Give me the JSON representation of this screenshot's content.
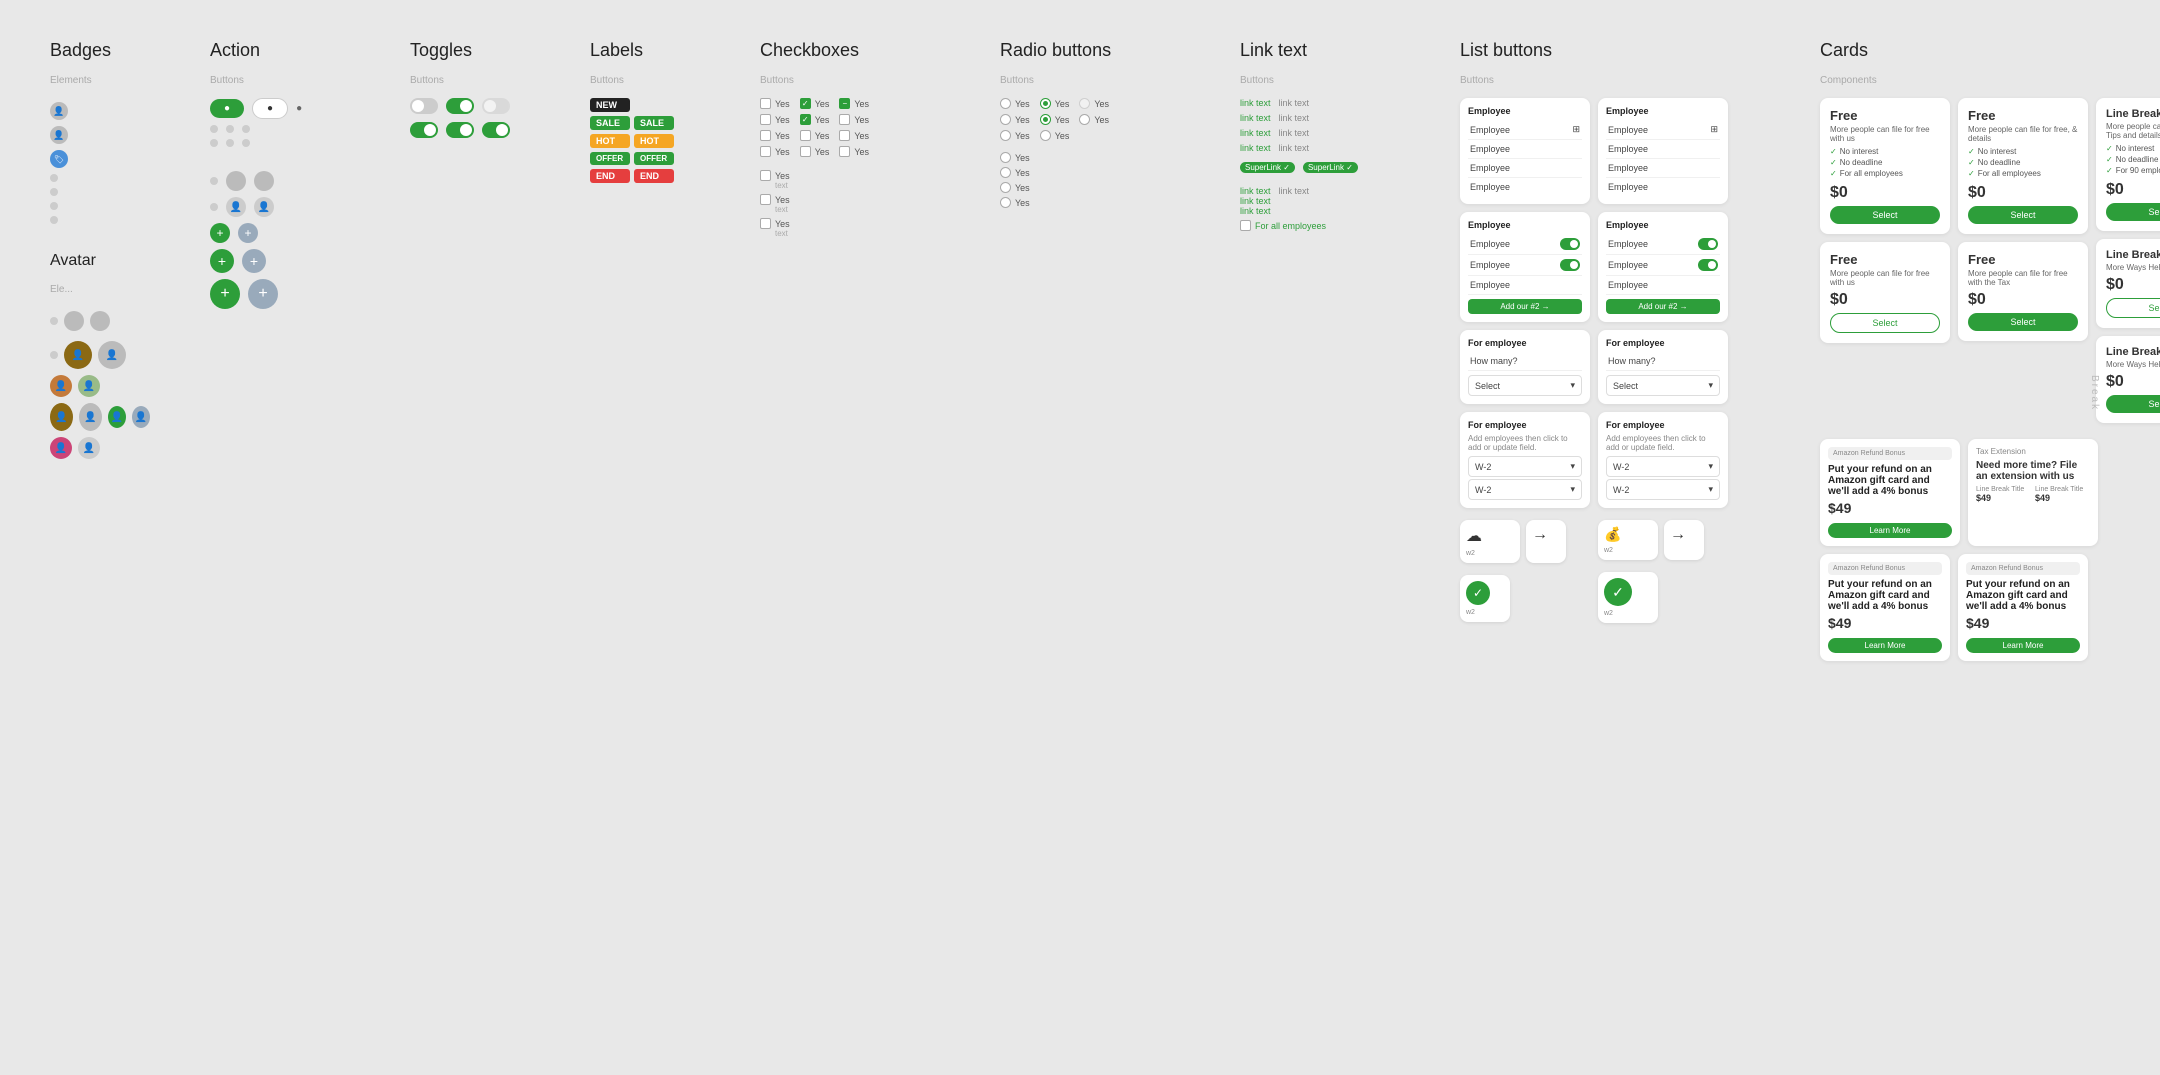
{
  "sections": {
    "badges": {
      "title": "Badges",
      "sub": "Elements"
    },
    "action": {
      "title": "Action",
      "sub": "Buttons"
    },
    "toggles": {
      "title": "Toggles",
      "sub": "Buttons"
    },
    "labels": {
      "title": "Labels",
      "sub": "Buttons"
    },
    "checkboxes": {
      "title": "Checkboxes",
      "sub": "Buttons"
    },
    "radioButtons": {
      "title": "Radio buttons",
      "sub": "Buttons"
    },
    "linkText": {
      "title": "Link text",
      "sub": "Buttons"
    },
    "listButtons": {
      "title": "List buttons",
      "sub": "Buttons"
    },
    "cards": {
      "title": "Cards",
      "sub": "Components"
    }
  },
  "cards": {
    "free_label": "Free",
    "price_zero": "$0",
    "price_49": "$49",
    "select_label": "Select",
    "learn_more": "Learn More",
    "line_break_title": "Line Break Title",
    "amazon_title": "Amazon Refund Bonus",
    "amazon_desc": "Put your refund on an Amazon gift card and we'll add a 4% bonus",
    "extension_title": "Need more time? File an extension with us",
    "tax_extension": "Tax Extension"
  },
  "colors": {
    "green": "#2d9e3a",
    "gray": "#999",
    "light_gray": "#e8e8e8",
    "dark": "#222",
    "yellow": "#f5a623",
    "red": "#e53e3e"
  }
}
